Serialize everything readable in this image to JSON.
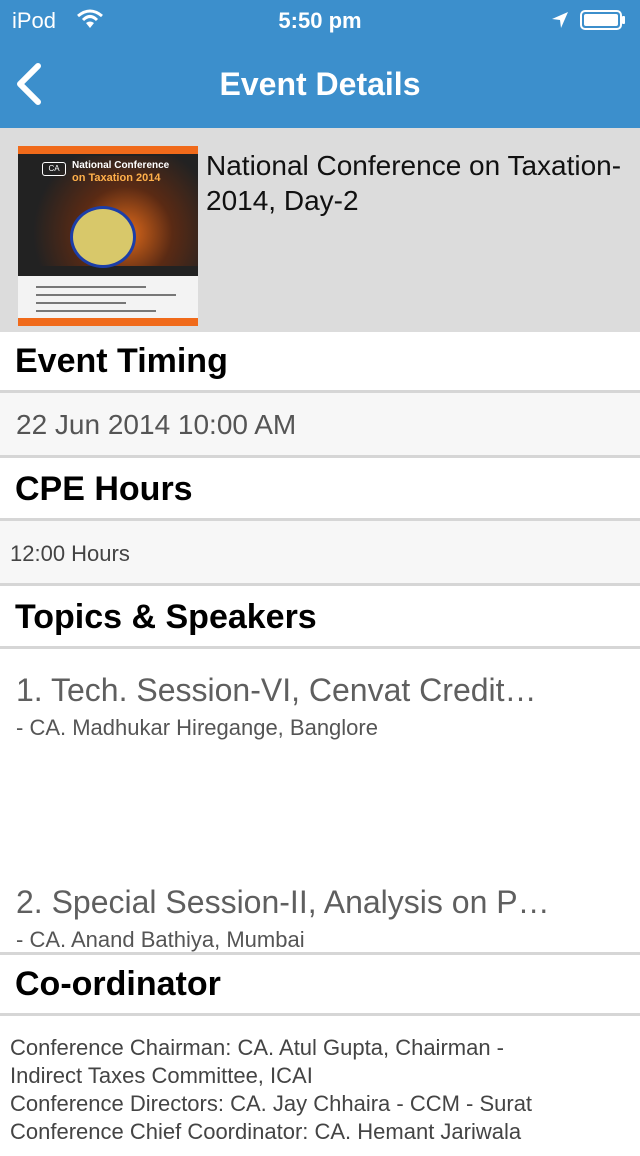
{
  "status_bar": {
    "carrier": "iPod",
    "time": "5:50 pm"
  },
  "nav": {
    "title": "Event Details",
    "back_icon": "chevron-left-icon",
    "bar_color": "#3c8fcc"
  },
  "event": {
    "title": "National Conference on Taxation-2014, Day-2",
    "poster": {
      "heading": "National Conference",
      "subheading": "on Taxation 2014",
      "logo_text": "CA"
    }
  },
  "sections": {
    "timing": {
      "label": "Event Timing",
      "value": "22 Jun 2014 10:00 AM"
    },
    "cpe": {
      "label": "CPE Hours",
      "value": "12:00 Hours"
    },
    "topics": {
      "label": "Topics & Speakers",
      "items": [
        {
          "title": "1. Tech. Session-VI, Cenvat Credit…",
          "speaker": "-  CA. Madhukar Hiregange, Banglore"
        },
        {
          "title": "2. Special Session-II, Analysis on P…",
          "speaker": "-  CA. Anand Bathiya, Mumbai"
        }
      ]
    },
    "coordinator": {
      "label": "Co-ordinator",
      "lines": [
        "Conference Chairman: CA. Atul Gupta, Chairman -",
        "Indirect Taxes Committee, ICAI",
        "Conference Directors: CA. Jay Chhaira - CCM - Surat",
        "Conference Chief Coordinator: CA. Hemant Jariwala"
      ]
    }
  }
}
